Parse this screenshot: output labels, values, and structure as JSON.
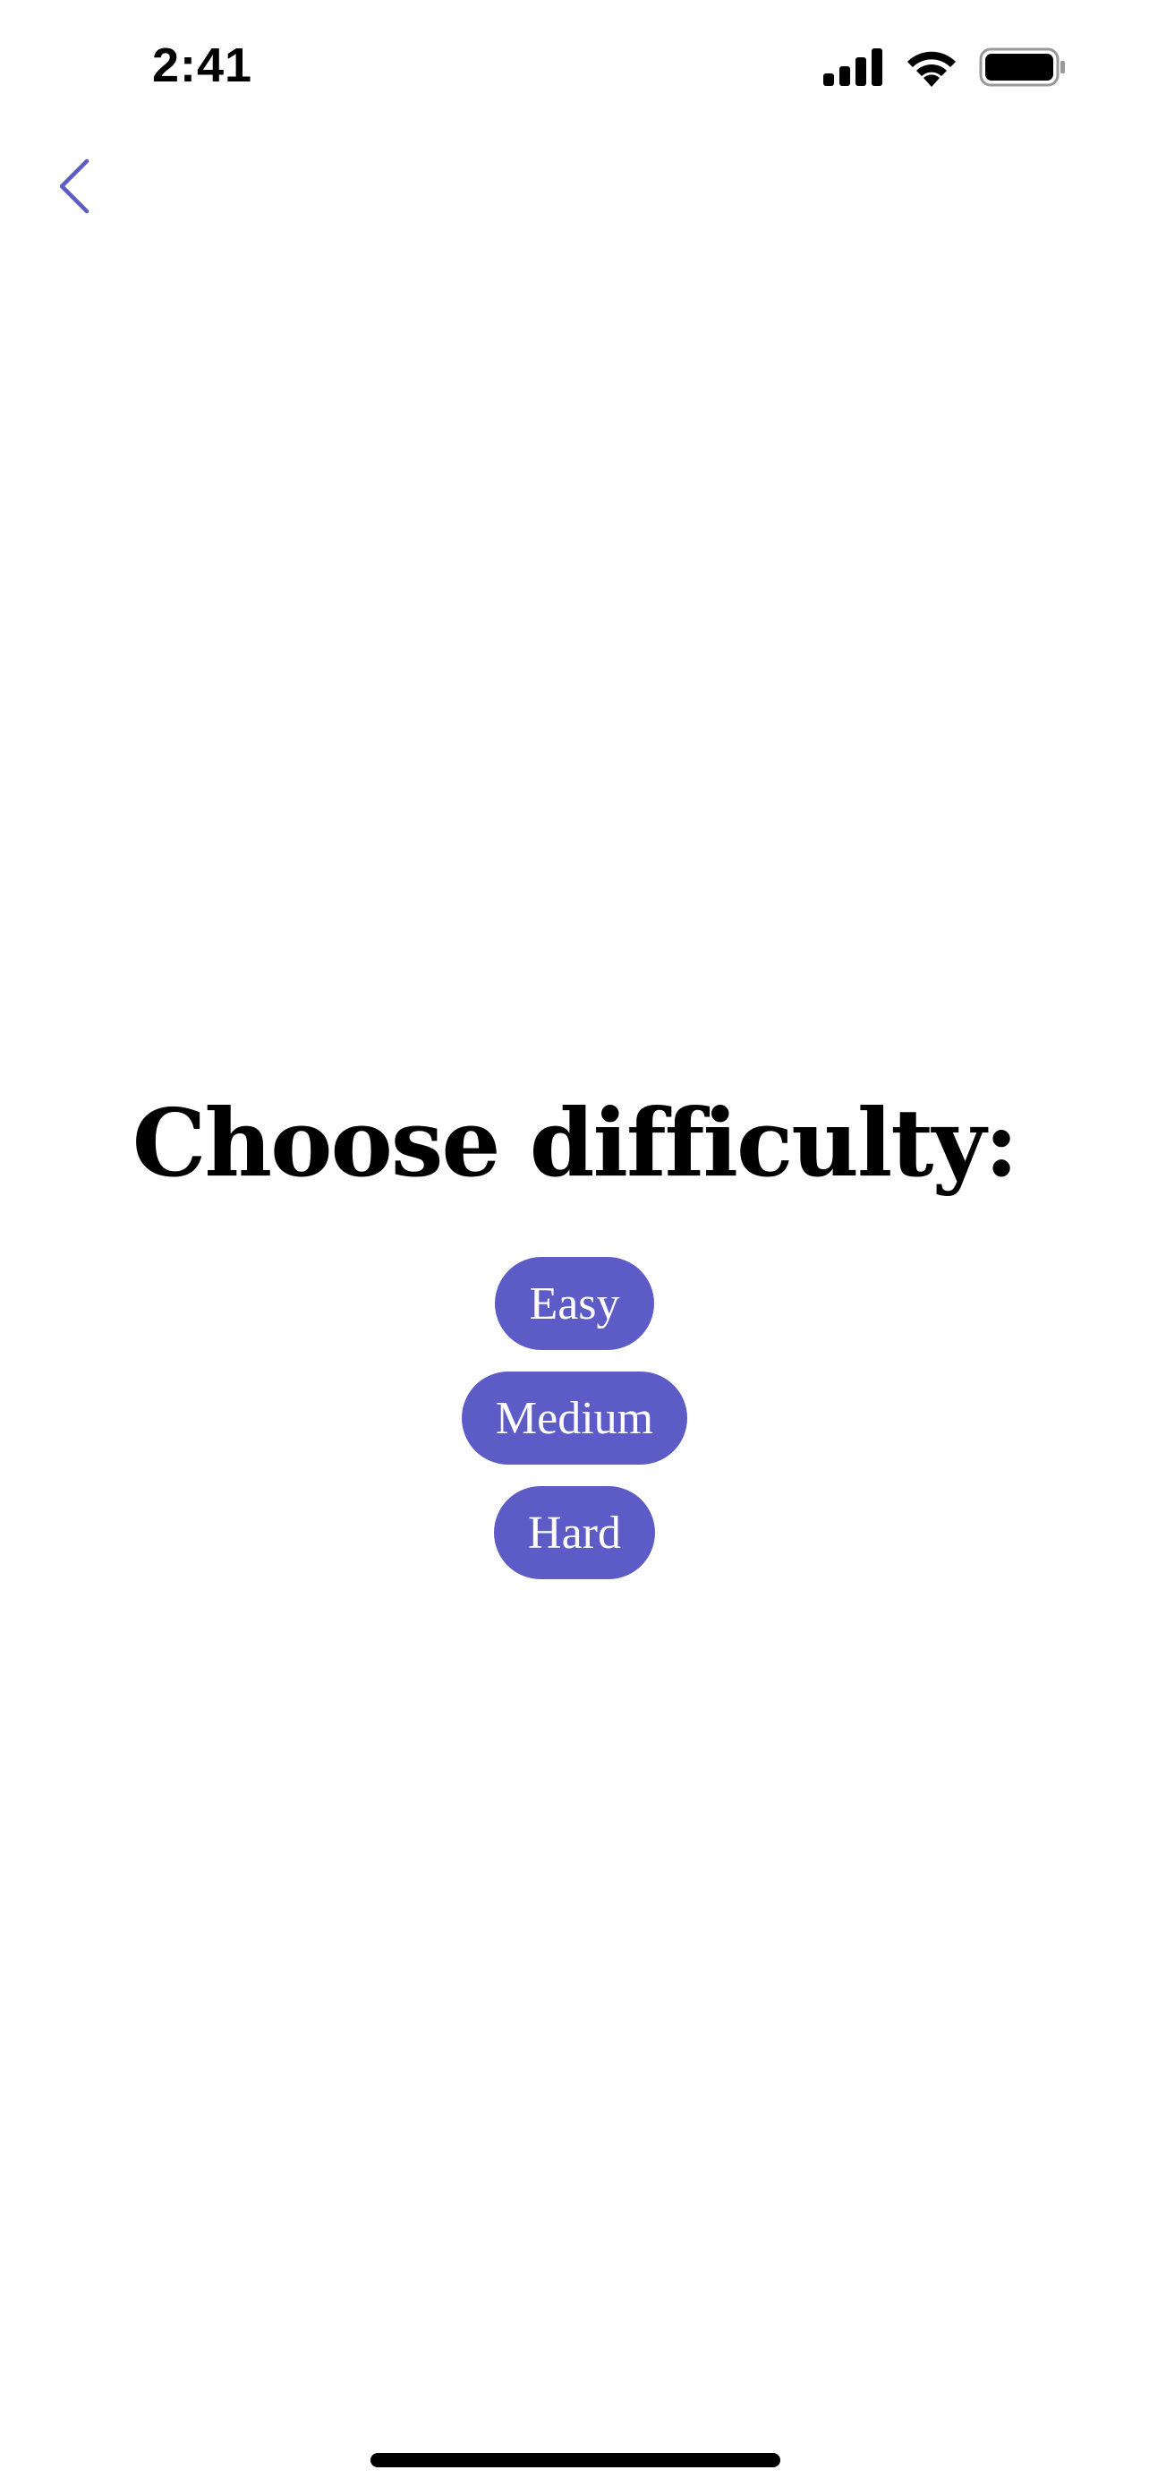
{
  "status_bar": {
    "time": "2:41",
    "icons": [
      "cellular-signal-icon",
      "wifi-icon",
      "battery-icon"
    ]
  },
  "nav": {
    "back_icon": "chevron-left-icon",
    "accent_color": "#5d5bc5"
  },
  "main": {
    "title": "Choose difficulty:",
    "options": [
      {
        "label": "Easy"
      },
      {
        "label": "Medium"
      },
      {
        "label": "Hard"
      }
    ],
    "button_color": "#5d5bc5",
    "button_text_color": "#ffffff"
  }
}
